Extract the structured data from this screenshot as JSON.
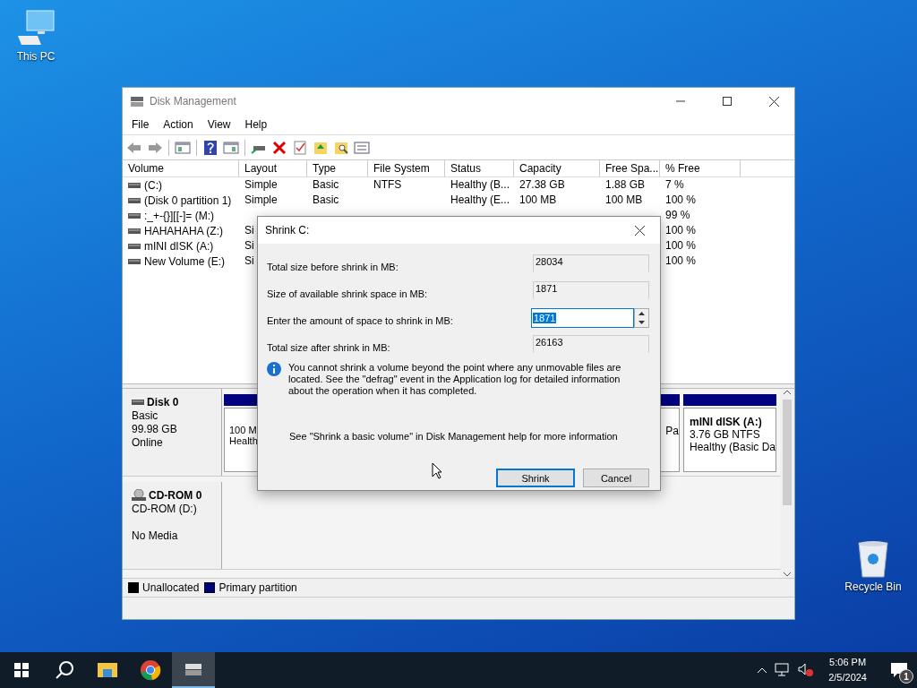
{
  "desktop_icons": [
    {
      "label": "This PC",
      "kind": "pc"
    },
    {
      "label": "Recycle Bin",
      "kind": "bin"
    }
  ],
  "window": {
    "title": "Disk Management",
    "menu": [
      "File",
      "Action",
      "View",
      "Help"
    ],
    "table": {
      "columns": [
        "Volume",
        "Layout",
        "Type",
        "File System",
        "Status",
        "Capacity",
        "Free Spa...",
        "% Free"
      ],
      "rows": [
        [
          " (C:)",
          "Simple",
          "Basic",
          "NTFS",
          "Healthy (B...",
          "27.38 GB",
          "1.88 GB",
          "7 %"
        ],
        [
          "(Disk 0 partition 1)",
          "Simple",
          "Basic",
          null,
          "Healthy (E...",
          "100 MB",
          "100 MB",
          "100 %"
        ],
        [
          ":_+-{}][[-]= (M:)",
          null,
          null,
          null,
          null,
          null,
          null,
          "99 %"
        ],
        [
          "HAHAHAHA (Z:)",
          "Si",
          null,
          null,
          null,
          null,
          null,
          "100 %"
        ],
        [
          "mINI dISK (A:)",
          "Si",
          null,
          null,
          null,
          null,
          null,
          "100 %"
        ],
        [
          "New Volume (E:)",
          "Si",
          null,
          null,
          null,
          null,
          null,
          "100 %"
        ]
      ]
    },
    "disks": [
      {
        "kind": "disk",
        "name": "Disk 0",
        "type": "Basic",
        "size": "99.98 GB",
        "status": "Online",
        "partitions": [
          {
            "lines": [
              "100 M",
              "Health"
            ]
          },
          {
            "lines": [
              "Pa"
            ]
          },
          {
            "title": "mINI dISK  (A:)",
            "lines": [
              "3.76 GB NTFS",
              "Healthy (Basic Da"
            ]
          }
        ]
      },
      {
        "kind": "cdrom",
        "name": "CD-ROM 0",
        "type": "CD-ROM (D:)",
        "status": "No Media"
      }
    ],
    "legend": [
      {
        "label": "Unallocated",
        "color": "#000000"
      },
      {
        "label": "Primary partition",
        "color": "#000080"
      }
    ]
  },
  "dialog": {
    "title": "Shrink C:",
    "fields": [
      {
        "label": "Total size before shrink in MB:",
        "value": "28034",
        "kind": "readonly"
      },
      {
        "label": "Size of available shrink space in MB:",
        "value": "1871",
        "kind": "readonly"
      },
      {
        "label": "Enter the amount of space to shrink in MB:",
        "value": "1871",
        "kind": "spin",
        "selected": true
      },
      {
        "label": "Total size after shrink in MB:",
        "value": "26163",
        "kind": "readonly"
      }
    ],
    "info": "You cannot shrink a volume beyond the point where any unmovable files are located. See the \"defrag\" event in the Application log for detailed information about the operation when it has completed.",
    "help": "See \"Shrink a basic volume\" in Disk Management help for more information",
    "buttons": [
      {
        "label": "Shrink",
        "default": true
      },
      {
        "label": "Cancel",
        "default": false
      }
    ]
  },
  "taskbar": {
    "apps": [
      {
        "kind": "explorer",
        "active": false
      },
      {
        "kind": "chrome",
        "active": false
      },
      {
        "kind": "diskmgmt",
        "active": true
      }
    ],
    "time": "5:06 PM",
    "date": "2/5/2024",
    "notifications": "1"
  }
}
